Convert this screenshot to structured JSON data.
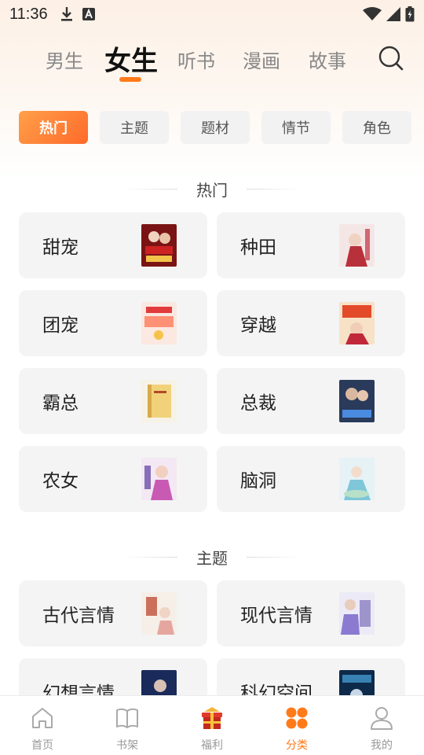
{
  "status_bar": {
    "time": "11:36",
    "left_icons": [
      "download-icon",
      "app-store-icon"
    ],
    "right_icons": [
      "wifi-icon",
      "signal-icon",
      "battery-icon"
    ]
  },
  "top_tabs": [
    {
      "label": "男生",
      "active": false
    },
    {
      "label": "女生",
      "active": true
    },
    {
      "label": "听书",
      "active": false
    },
    {
      "label": "漫画",
      "active": false
    },
    {
      "label": "故事",
      "active": false
    }
  ],
  "search_icon": "search-icon",
  "chips": [
    {
      "label": "热门",
      "active": true
    },
    {
      "label": "主题",
      "active": false
    },
    {
      "label": "题材",
      "active": false
    },
    {
      "label": "情节",
      "active": false
    },
    {
      "label": "角色",
      "active": false
    }
  ],
  "sections": [
    {
      "title": "热门",
      "cards": [
        {
          "label": "甜宠"
        },
        {
          "label": "种田"
        },
        {
          "label": "团宠"
        },
        {
          "label": "穿越"
        },
        {
          "label": "霸总"
        },
        {
          "label": "总裁"
        },
        {
          "label": "农女"
        },
        {
          "label": "脑洞"
        }
      ]
    },
    {
      "title": "主题",
      "cards": [
        {
          "label": "古代言情"
        },
        {
          "label": "现代言情"
        },
        {
          "label": "幻想言情"
        },
        {
          "label": "科幻空间"
        }
      ]
    }
  ],
  "bottom_nav": [
    {
      "label": "首页",
      "icon": "home-icon",
      "active": false
    },
    {
      "label": "书架",
      "icon": "bookshelf-icon",
      "active": false
    },
    {
      "label": "福利",
      "icon": "gift-icon",
      "active": false
    },
    {
      "label": "分类",
      "icon": "category-icon",
      "active": true
    },
    {
      "label": "我的",
      "icon": "profile-icon",
      "active": false
    }
  ],
  "colors": {
    "accent": "#ff7a1a",
    "chip_gradient_start": "#ffa04a",
    "chip_gradient_end": "#ff6a2a",
    "card_bg": "#f4f4f4",
    "inactive_text": "#999999"
  }
}
